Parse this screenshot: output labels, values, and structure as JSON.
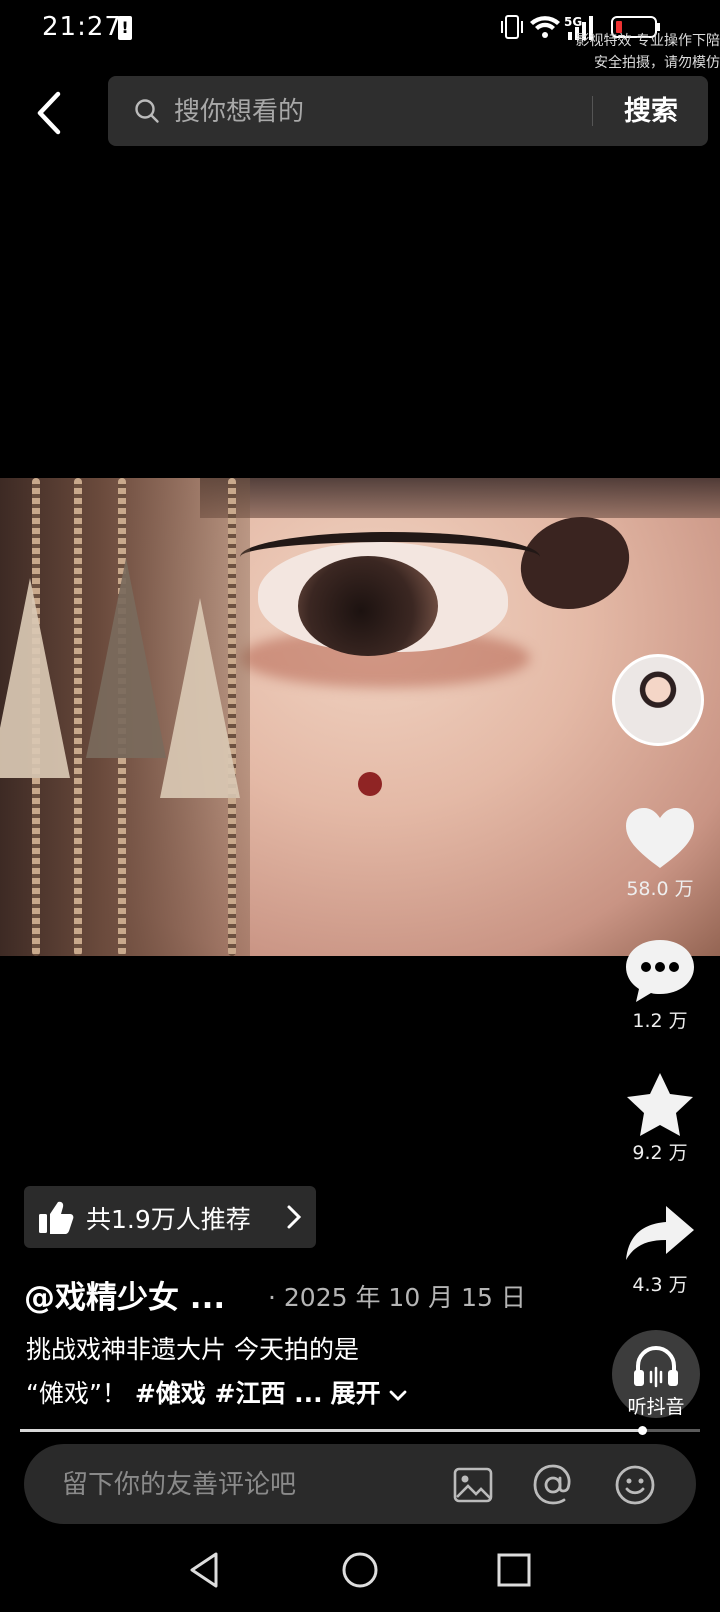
{
  "status_bar": {
    "time": "21:27",
    "battery_saver_glyph": "!",
    "network": "5G",
    "watermark_line1": "影视特效 专业操作下陪",
    "watermark_line2": "安全拍摄，请勿模仿"
  },
  "search": {
    "placeholder": "搜你想看的",
    "button_label": "搜索"
  },
  "video": {
    "progress": 0.915
  },
  "sidebar": {
    "like_count": "58.0 万",
    "comment_count": "1.2 万",
    "favorite_count": "9.2 万",
    "share_count": "4.3 万",
    "listen_label": "听抖音"
  },
  "recommend": {
    "text": "共1.9万人推荐"
  },
  "post": {
    "author": "@戏精少女 ...",
    "date": "· 2025 年 10 月 15 日",
    "caption_line1": "挑战戏神非遗大片 今天拍的是",
    "caption_quote": "“傩戏”！",
    "caption_tags": "#傩戏 #江西 ...",
    "expand_label": "展开"
  },
  "comment": {
    "placeholder": "留下你的友善评论吧"
  },
  "colors": {
    "background": "#000000",
    "search_box": "#2e2e2e",
    "pill": "#2b2b2b",
    "comment_bar": "#2a2a2a"
  },
  "icons": [
    "back-arrow-icon",
    "search-icon",
    "heart-icon",
    "comment-dots-icon",
    "star-icon",
    "share-arrow-icon",
    "headphones-icon",
    "thumbs-up-icon",
    "chevron-right-icon",
    "chevron-down-icon",
    "image-icon",
    "at-icon",
    "emoji-icon",
    "nav-back-icon",
    "nav-home-icon",
    "nav-recents-icon"
  ]
}
